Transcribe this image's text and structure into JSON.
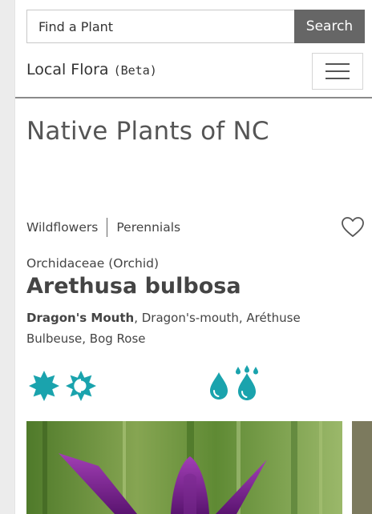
{
  "search": {
    "placeholder": "Find a Plant",
    "button_label": "Search"
  },
  "brand": {
    "name": "Local Flora",
    "tag": "(Beta)"
  },
  "page_title": "Native Plants of NC",
  "categories": [
    "Wildflowers",
    "Perennials"
  ],
  "plant": {
    "family": "Orchidaceae (Orchid)",
    "scientific_name": "Arethusa bulbosa",
    "primary_common_name": "Dragon's Mouth",
    "other_common_names": ", Dragon's-mouth, Aréthuse Bulbeuse, Bog Rose"
  },
  "icons": {
    "sun": [
      "full-sun-icon",
      "part-sun-icon"
    ],
    "water": [
      "moist-icon",
      "wet-icon"
    ]
  },
  "colors": {
    "accent": "#1aa3ad",
    "search_button": "#666666",
    "text": "#444444"
  }
}
